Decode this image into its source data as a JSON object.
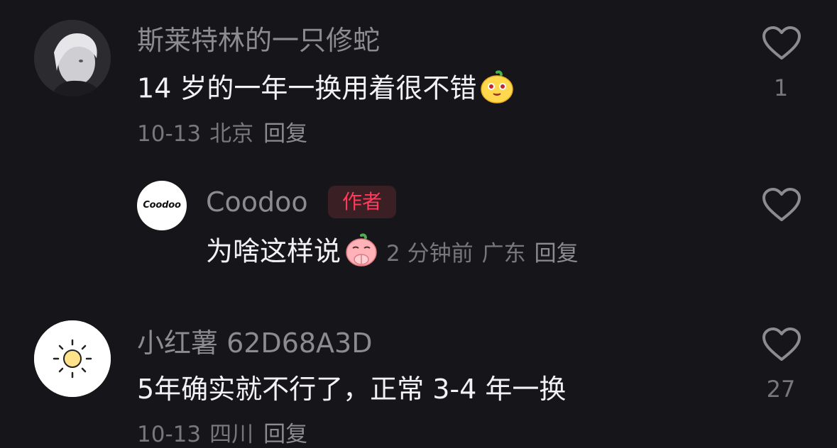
{
  "comments": [
    {
      "username": "斯莱特林的一只修蛇",
      "content": "14 岁的一年一换用着很不错",
      "emoji": "yellow-face-emoji",
      "date": "10-13",
      "location": "北京",
      "reply_label": "回复",
      "like_count": "1"
    },
    {
      "username": "Coodoo",
      "avatar_text": "Coodoo",
      "badge": "作者",
      "badge_color": "#ff3b5c",
      "content": "为啥这样说",
      "emoji": "pink-praying-face-emoji",
      "time": "2 分钟前",
      "location": "广东",
      "reply_label": "回复"
    },
    {
      "username": "小红薯 62D68A3D",
      "avatar_icon": "sun-icon",
      "content": "5年确实就不行了，正常 3-4 年一换",
      "date": "10-13",
      "location": "四川",
      "reply_label": "回复",
      "like_count": "27"
    }
  ],
  "colors": {
    "background": "#16161a",
    "username": "#8b8b90",
    "content": "#f2f2f4",
    "meta": "#77777c"
  }
}
